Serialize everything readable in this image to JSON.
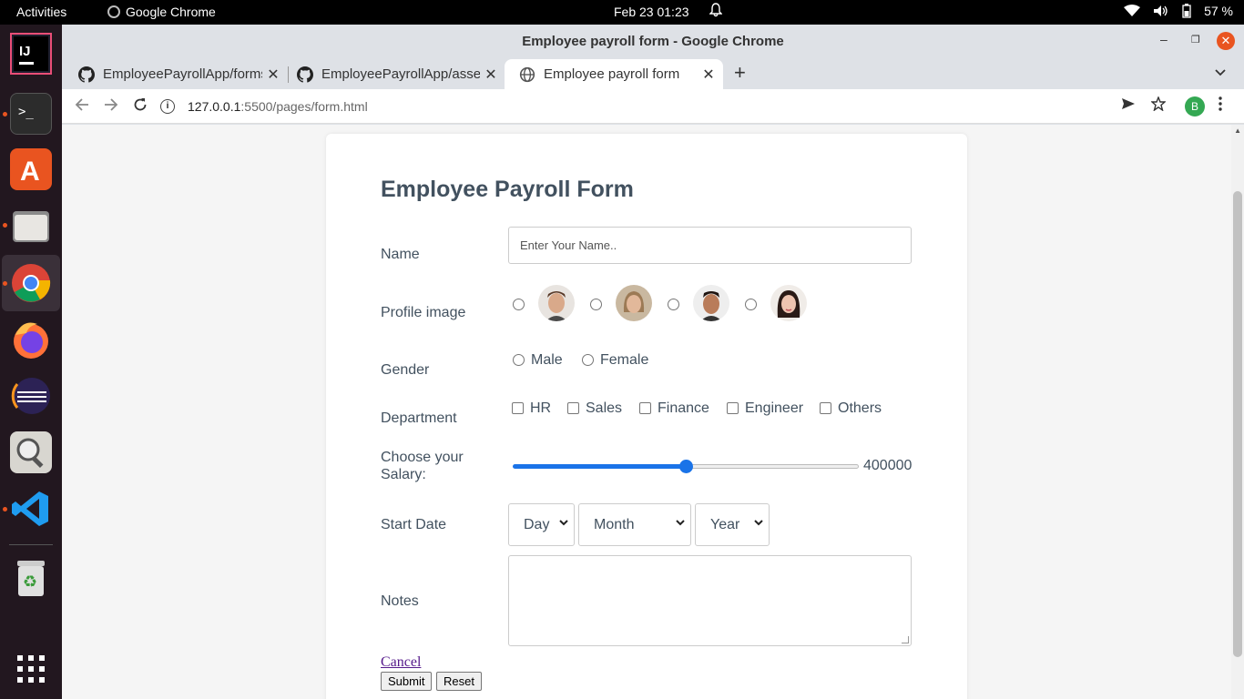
{
  "topbar": {
    "activities": "Activities",
    "app": "Google Chrome",
    "clock": "Feb 23  01:23",
    "battery": "57 %"
  },
  "dock": {
    "apps": [
      "intellij-icon",
      "terminal-icon",
      "software-center-icon",
      "files-icon",
      "chrome-icon",
      "firefox-icon",
      "eclipse-icon",
      "image-viewer-icon",
      "vscode-icon",
      "trash-icon",
      "app-grid-icon"
    ]
  },
  "window": {
    "title": "Employee payroll form - Google Chrome"
  },
  "tabs": [
    {
      "label": "EmployeePayrollApp/forms"
    },
    {
      "label": "EmployeePayrollApp/assets"
    },
    {
      "label": "Employee payroll form"
    }
  ],
  "address": {
    "host": "127.0.0.1",
    "rest": ":5500/pages/form.html"
  },
  "profile": {
    "initial": "B"
  },
  "form": {
    "title": "Employee Payroll Form",
    "name_label": "Name",
    "name_placeholder": "Enter Your Name..",
    "profile_label": "Profile image",
    "gender_label": "Gender",
    "gender_options": [
      "Male",
      "Female"
    ],
    "department_label": "Department",
    "departments": [
      "HR",
      "Sales",
      "Finance",
      "Engineer",
      "Others"
    ],
    "salary_label": "Choose your Salary:",
    "salary_value": "400000",
    "start_label": "Start Date",
    "day": "Day",
    "month": "Month",
    "year": "Year",
    "notes_label": "Notes",
    "cancel": "Cancel",
    "submit": "Submit",
    "reset": "Reset"
  }
}
